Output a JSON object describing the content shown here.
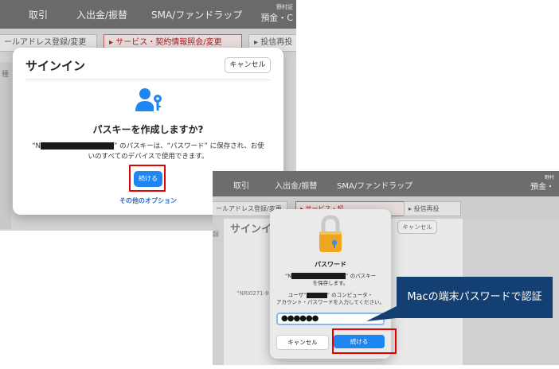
{
  "screenshot1": {
    "nav": {
      "item1": "取引",
      "item2": "入出金/振替",
      "item3": "SMA/ファンドラップ",
      "right_top": "野村証",
      "right_bottom": "預金・C"
    },
    "tabs": {
      "tab1": "ールアドレス登録/変更",
      "tab2": "▸ サービス・契約情報照会/変更",
      "tab3": "▸ 投信再投"
    },
    "side_text": "種",
    "dialog": {
      "title": "サインイン",
      "cancel": "キャンセル",
      "heading": "パスキーを作成しますか?",
      "desc_prefix": "“N",
      "desc_middle": "” のパスキーは、“パスワード” に保存され、お使",
      "desc_line2": "いのすべてのデバイスで使用できます。",
      "continue": "続ける",
      "other_options": "その他のオプション"
    }
  },
  "screenshot2": {
    "nav": {
      "item1": "取引",
      "item2": "入出金/振替",
      "item3": "SMA/ファンドラップ",
      "right_top": "野村",
      "right_bottom": "預金・"
    },
    "tabs": {
      "tab1": "ールアドレス登録/変更",
      "tab2": "▸ サービス・契",
      "tab3": "▸ 投信再投"
    },
    "bg": {
      "side_text": "録",
      "title": "サインイン",
      "cancel": "キャンセル",
      "nri": "“NRI0271-8"
    },
    "dialog": {
      "title": "パスワード",
      "msg_prefix": "“N",
      "msg_suffix": "” のパスキー",
      "msg_line2": "を保存します。",
      "user_prefix": "ユーザ“",
      "user_suffix": "” のコンピュータ・",
      "user_line2": "アカウント・パスワードを入力してください。",
      "password_value": "●●●●●●",
      "cancel": "キャンセル",
      "continue": "続ける"
    }
  },
  "callout": {
    "text": "Macの端末パスワードで認証"
  },
  "colors": {
    "accent_blue": "#1d86f0",
    "highlight_red": "#e30000",
    "callout_navy": "#133f72"
  }
}
